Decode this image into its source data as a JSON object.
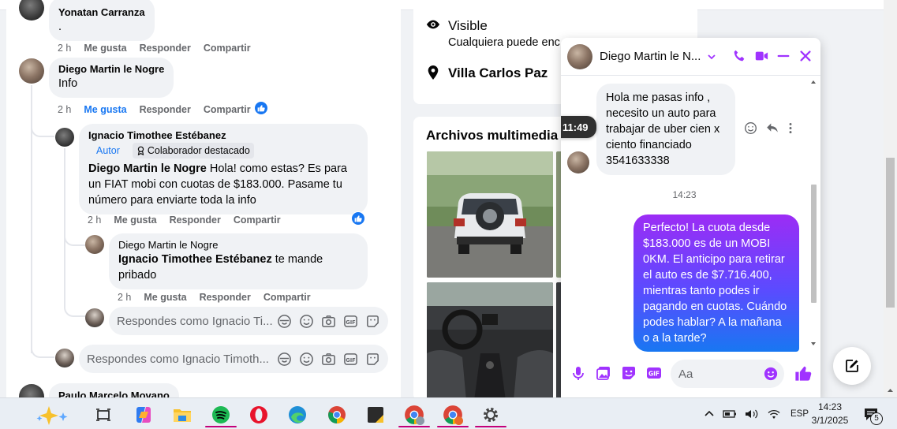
{
  "comments": [
    {
      "author": "Yonatan Carranza",
      "text": ".",
      "time": "2 h",
      "like": "Me gusta",
      "reply": "Responder",
      "share": "Compartir"
    },
    {
      "author": "Diego Martin le Nogre",
      "text": "Info",
      "time": "2 h",
      "like": "Me gusta",
      "reply": "Responder",
      "share": "Compartir"
    },
    {
      "author": "Ignacio Timothee Estébanez",
      "author_tag": "Autor",
      "badge": "Colaborador destacado",
      "mention": "Diego Martin le Nogre",
      "text": " Hola! como estas? Es para un FIAT mobi con cuotas de $183.000. Pasame tu número para enviarte toda la info",
      "time": "2 h",
      "like": "Me gusta",
      "reply": "Responder",
      "share": "Compartir"
    },
    {
      "author": "Diego Martin le Nogre",
      "mention": "Ignacio Timothee Estébanez",
      "text": " te mande pribado",
      "time": "2 h",
      "like": "Me gusta",
      "reply": "Responder",
      "share": "Compartir"
    },
    {
      "author": "Paulo Marcelo Movano"
    }
  ],
  "reply_inputs": [
    {
      "placeholder": "Respondes como Ignacio Ti..."
    },
    {
      "placeholder": "Respondes como Ignacio Timoth..."
    }
  ],
  "info": {
    "visibility_title": "Visible",
    "visibility_desc": "Cualquiera puede enc",
    "location": "Villa Carlos Paz"
  },
  "media": {
    "title": "Archivos multimedia r"
  },
  "chat": {
    "contact": "Diego Martin le N...",
    "hover_time": "11:49",
    "incoming": "Hola me pasas info ,\nnecesito un auto para\ntrabajar de uber cien x\nciento  financiado\n3541633338",
    "timestamp": "14:23",
    "outgoing": "Perfecto! La cuota desde $183.000 es de un MOBI 0KM. El anticipo para retirar el auto es de $7.716.400, mientras tanto podes ir pagando en cuotas. Cuándo podes hablar? A la mañana o a la tarde?",
    "input_placeholder": "Aa",
    "accent": "#a033ff"
  },
  "taskbar": {
    "lang": "ESP",
    "time": "14:23",
    "date": "3/1/2025",
    "notifications": "5"
  }
}
